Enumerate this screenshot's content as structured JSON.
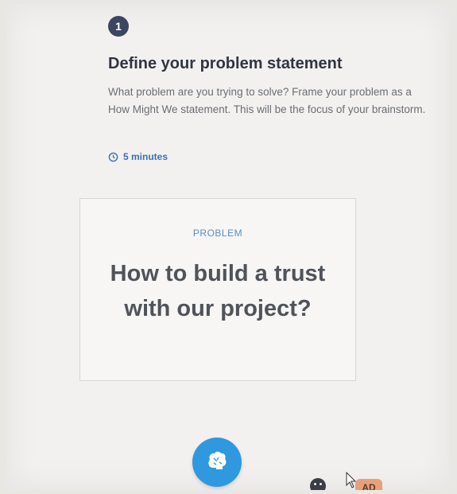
{
  "step": {
    "number": "1",
    "title": "Define your problem statement",
    "description": "What problem are you trying to solve? Frame your problem as a How Might We statement. This will be the focus of your brainstorm.",
    "duration": "5 minutes"
  },
  "card": {
    "label": "PROBLEM",
    "question": "How to build a trust with our project?"
  },
  "toolbar": {
    "avatar_initials": "AD"
  },
  "colors": {
    "accent_blue": "#2f98de",
    "badge_dark": "#3b4660",
    "avatar_bg": "#e9a07a"
  }
}
